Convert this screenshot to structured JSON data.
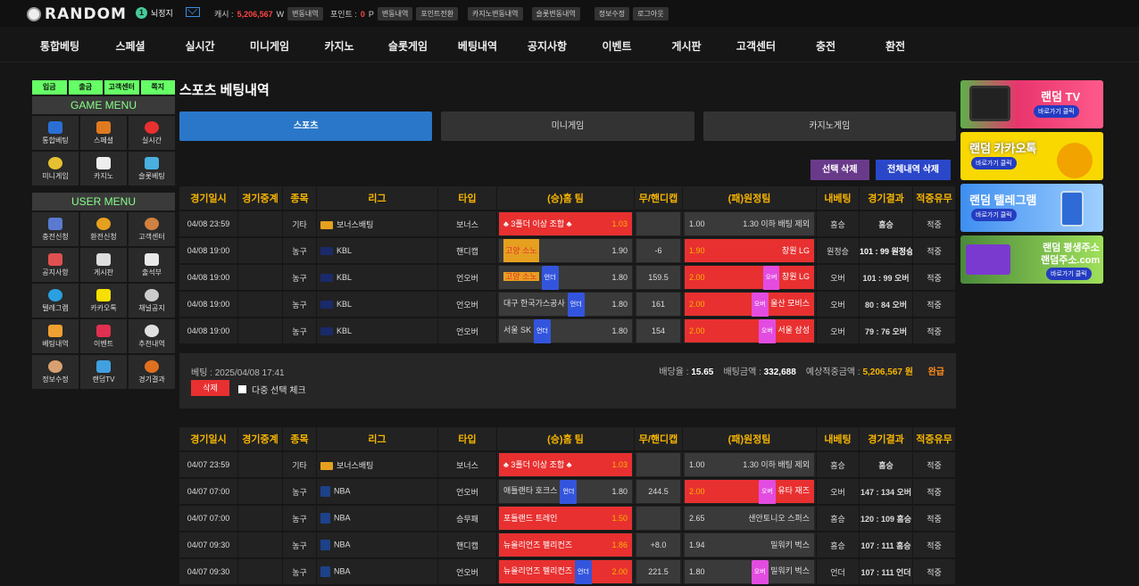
{
  "logo": "RANDOM",
  "user": {
    "level": "1",
    "name": "뇌정지"
  },
  "cash": {
    "label": "캐시 :",
    "amount": "5,206,567",
    "unit": "W",
    "btn": "변동내역"
  },
  "point": {
    "label": "포인트 :",
    "amount": "0",
    "unit": "P",
    "btn1": "변동내역",
    "btn2": "포인트전환"
  },
  "topbtns": [
    "카지노변동내역",
    "슬롯변동내역",
    "정보수정",
    "로그아웃"
  ],
  "nav": [
    "통합베팅",
    "스페셜",
    "실시간",
    "미니게임",
    "카지노",
    "슬롯게임",
    "베팅내역",
    "공지사항",
    "이벤트",
    "게시판",
    "고객센터",
    "충전",
    "환전"
  ],
  "quick": [
    "입금",
    "출금",
    "고객센터",
    "쪽지"
  ],
  "game_menu": {
    "title": "GAME MENU",
    "items": [
      "통합베팅",
      "스페셜",
      "실시간",
      "미니게임",
      "카지노",
      "슬롯베팅"
    ]
  },
  "user_menu": {
    "title": "USER MENU",
    "items": [
      "충전신청",
      "환전신청",
      "고객센터",
      "공지사항",
      "게시판",
      "출석부",
      "텔레그램",
      "카카오톡",
      "채널공지",
      "베팅내역",
      "이벤트",
      "추천내역",
      "정보수정",
      "랜덤TV",
      "경기결과"
    ]
  },
  "page_title": "스포츠 베팅내역",
  "tabs": [
    "스포츠",
    "미니게임",
    "카지노게임"
  ],
  "actions": {
    "select_delete": "선택 삭제",
    "all_delete": "전체내역 삭제"
  },
  "headers": [
    "경기일시",
    "경기중계",
    "종목",
    "리그",
    "타입",
    "(승)홈 팀",
    "무/핸디캡",
    "(패)원정팀",
    "내베팅",
    "경기결과",
    "적중유무"
  ],
  "table1": [
    {
      "dt": "04/08 23:59",
      "sport": "기타",
      "league": "보너스배팅",
      "type": "보너스",
      "home": "♣ 3폴더 이상 조합 ♣",
      "ho": "1.03",
      "mid": "",
      "ao": "1.00",
      "away": "1.30 이하 배팅 제외",
      "bet": "홈승",
      "res": "홈승",
      "hit": "적중"
    },
    {
      "dt": "04/08 19:00",
      "sport": "농구",
      "league": "KBL",
      "type": "핸디캡",
      "home": "고양 소노",
      "ho": "1.90",
      "mid": "-6",
      "ao": "1.90",
      "away": "창원 LG",
      "bet": "원정승",
      "res": "101 : 99 원정승",
      "hit": "적중"
    },
    {
      "dt": "04/08 19:00",
      "sport": "농구",
      "league": "KBL",
      "type": "언오버",
      "home": "고양 소노",
      "ho": "1.80",
      "mid": "159.5",
      "ao": "2.00",
      "away": "창원 LG",
      "bet": "오버",
      "res": "101 : 99 오버",
      "hit": "적중"
    },
    {
      "dt": "04/08 19:00",
      "sport": "농구",
      "league": "KBL",
      "type": "언오버",
      "home": "대구 한국가스공사",
      "ho": "1.80",
      "mid": "161",
      "ao": "2.00",
      "away": "울산 모비스",
      "bet": "오버",
      "res": "80 : 84 오버",
      "hit": "적중"
    },
    {
      "dt": "04/08 19:00",
      "sport": "농구",
      "league": "KBL",
      "type": "언오버",
      "home": "서울 SK",
      "ho": "1.80",
      "mid": "154",
      "ao": "2.00",
      "away": "서울 삼성",
      "bet": "오버",
      "res": "79 : 76 오버",
      "hit": "적중"
    }
  ],
  "summary": {
    "bet_time": "베팅 : 2025/04/08 17:41",
    "odds_label": "배당율 :",
    "odds": "15.65",
    "amount_label": "배팅금액 :",
    "amount": "332,688",
    "exp_label": "예상적중금액 :",
    "exp": "5,206,567 원",
    "status": "완급",
    "delete": "삭제",
    "multi": "다중 선택 체크",
    "under": "언더",
    "over": "오버"
  },
  "table2": [
    {
      "dt": "04/07 23:59",
      "sport": "기타",
      "league": "보너스배팅",
      "type": "보너스",
      "home": "♣ 3폴더 이상 조합 ♣",
      "ho": "1.03",
      "mid": "",
      "ao": "1.00",
      "away": "1.30 이하 배팅 제외",
      "bet": "홈승",
      "res": "홈승",
      "hit": "적중"
    },
    {
      "dt": "04/07 07:00",
      "sport": "농구",
      "league": "NBA",
      "type": "언오버",
      "home": "애틀랜타 호크스",
      "ho": "1.80",
      "mid": "244.5",
      "ao": "2.00",
      "away": "유타 재즈",
      "bet": "오버",
      "res": "147 : 134 오버",
      "hit": "적중"
    },
    {
      "dt": "04/07 07:00",
      "sport": "농구",
      "league": "NBA",
      "type": "승무패",
      "home": "포틀랜드 트레인",
      "ho": "1.50",
      "mid": "",
      "ao": "2.65",
      "away": "샌안토니오 스퍼스",
      "bet": "홈승",
      "res": "120 : 109 홈승",
      "hit": "적중"
    },
    {
      "dt": "04/07 09:30",
      "sport": "농구",
      "league": "NBA",
      "type": "핸디캡",
      "home": "뉴올리언즈 펠리컨즈",
      "ho": "1.86",
      "mid": "+8.0",
      "ao": "1.94",
      "away": "밀워키 벅스",
      "bet": "홈승",
      "res": "107 : 111 홈승",
      "hit": "적중"
    },
    {
      "dt": "04/07 09:30",
      "sport": "농구",
      "league": "NBA",
      "type": "언오버",
      "home": "뉴올리언즈 펠리컨즈",
      "ho": "2.00",
      "mid": "221.5",
      "ao": "1.80",
      "away": "밀워키 벅스",
      "bet": "언더",
      "res": "107 : 111 언더",
      "hit": "적중"
    }
  ],
  "banners": [
    {
      "title": "랜덤 TV",
      "sub": "바로가기 클릭"
    },
    {
      "title": "랜덤 카카오톡",
      "sub": "바로가기 클릭"
    },
    {
      "title": "랜덤 텔레그램",
      "sub": "바로가기 클릭"
    },
    {
      "title": "랜덤 평생주소",
      "title2": "랜덤주소.com",
      "sub": "바로가기 클릭"
    }
  ]
}
